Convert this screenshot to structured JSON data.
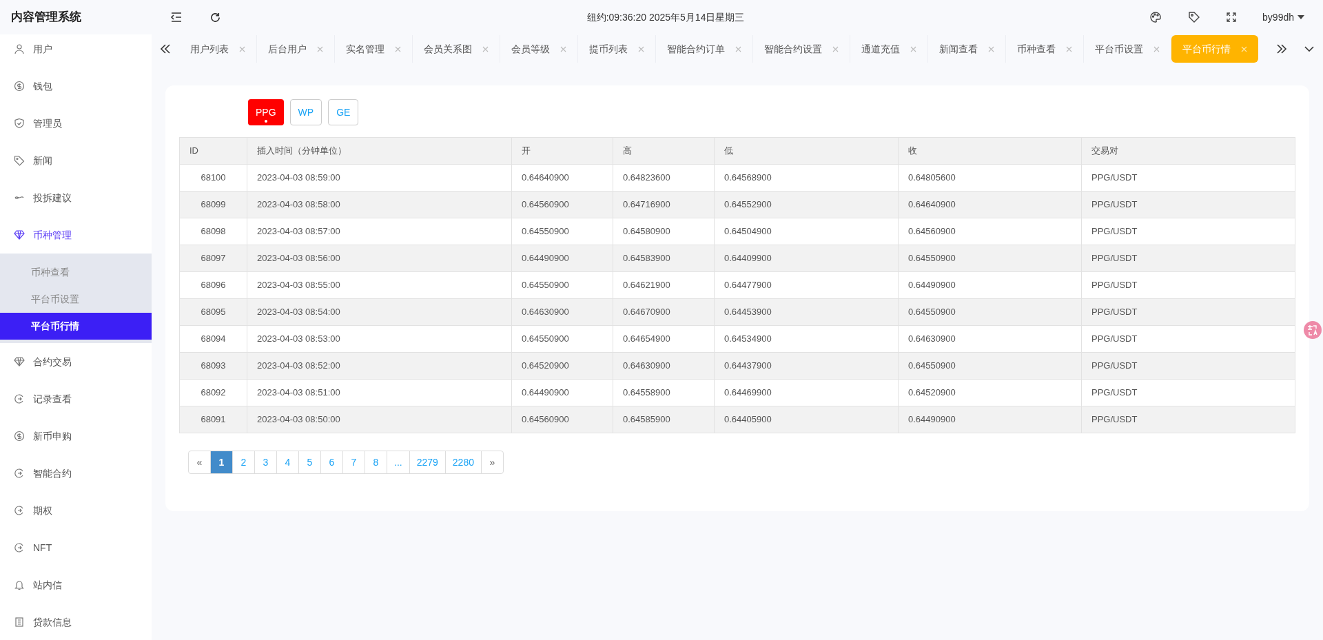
{
  "app_title": "内容管理系统",
  "header": {
    "clock": "纽约:09:36:20 2025年5月14日星期三",
    "user": "by99dh"
  },
  "sidebar": {
    "items": [
      {
        "label": "用户",
        "selected": false,
        "expanded": false
      },
      {
        "label": "钱包",
        "selected": false,
        "expanded": false
      },
      {
        "label": "管理员",
        "selected": false,
        "expanded": false
      },
      {
        "label": "新闻",
        "selected": false,
        "expanded": false
      },
      {
        "label": "投拆建议",
        "selected": false,
        "expanded": false
      },
      {
        "label": "币种管理",
        "selected": false,
        "expanded": true,
        "children": [
          {
            "label": "币种查看",
            "selected": false
          },
          {
            "label": "平台币设置",
            "selected": false
          },
          {
            "label": "平台币行情",
            "selected": true
          }
        ]
      },
      {
        "label": "合约交易",
        "selected": false,
        "expanded": false
      },
      {
        "label": "记录查看",
        "selected": false,
        "expanded": false
      },
      {
        "label": "新币申购",
        "selected": false,
        "expanded": false
      },
      {
        "label": "智能合约",
        "selected": false,
        "expanded": false
      },
      {
        "label": "期权",
        "selected": false,
        "expanded": false
      },
      {
        "label": "NFT",
        "selected": false,
        "expanded": false
      },
      {
        "label": "站内信",
        "selected": false,
        "expanded": false
      },
      {
        "label": "贷款信息",
        "selected": false,
        "expanded": false
      }
    ]
  },
  "tabs": [
    {
      "label": "用户列表",
      "selected": false
    },
    {
      "label": "后台用户",
      "selected": false
    },
    {
      "label": "实名管理",
      "selected": false
    },
    {
      "label": "会员关系图",
      "selected": false
    },
    {
      "label": "会员等级",
      "selected": false
    },
    {
      "label": "提币列表",
      "selected": false
    },
    {
      "label": "智能合约订单",
      "selected": false
    },
    {
      "label": "智能合约设置",
      "selected": false
    },
    {
      "label": "通道充值",
      "selected": false
    },
    {
      "label": "新闻查看",
      "selected": false
    },
    {
      "label": "币种查看",
      "selected": false
    },
    {
      "label": "平台币设置",
      "selected": false
    },
    {
      "label": "平台币行情",
      "selected": true
    }
  ],
  "coin_buttons": [
    {
      "label": "PPG",
      "selected": true
    },
    {
      "label": "WP",
      "selected": false
    },
    {
      "label": "GE",
      "selected": false
    }
  ],
  "table": {
    "columns": [
      "ID",
      "插入时间（分钟单位）",
      "开",
      "高",
      "低",
      "收",
      "交易对"
    ],
    "rows": [
      [
        "68100",
        "2023-04-03 08:59:00",
        "0.64640900",
        "0.64823600",
        "0.64568900",
        "0.64805600",
        "PPG/USDT"
      ],
      [
        "68099",
        "2023-04-03 08:58:00",
        "0.64560900",
        "0.64716900",
        "0.64552900",
        "0.64640900",
        "PPG/USDT"
      ],
      [
        "68098",
        "2023-04-03 08:57:00",
        "0.64550900",
        "0.64580900",
        "0.64504900",
        "0.64560900",
        "PPG/USDT"
      ],
      [
        "68097",
        "2023-04-03 08:56:00",
        "0.64490900",
        "0.64583900",
        "0.64409900",
        "0.64550900",
        "PPG/USDT"
      ],
      [
        "68096",
        "2023-04-03 08:55:00",
        "0.64550900",
        "0.64621900",
        "0.64477900",
        "0.64490900",
        "PPG/USDT"
      ],
      [
        "68095",
        "2023-04-03 08:54:00",
        "0.64630900",
        "0.64670900",
        "0.64453900",
        "0.64550900",
        "PPG/USDT"
      ],
      [
        "68094",
        "2023-04-03 08:53:00",
        "0.64550900",
        "0.64654900",
        "0.64534900",
        "0.64630900",
        "PPG/USDT"
      ],
      [
        "68093",
        "2023-04-03 08:52:00",
        "0.64520900",
        "0.64630900",
        "0.64437900",
        "0.64550900",
        "PPG/USDT"
      ],
      [
        "68092",
        "2023-04-03 08:51:00",
        "0.64490900",
        "0.64558900",
        "0.64469900",
        "0.64520900",
        "PPG/USDT"
      ],
      [
        "68091",
        "2023-04-03 08:50:00",
        "0.64560900",
        "0.64585900",
        "0.64405900",
        "0.64490900",
        "PPG/USDT"
      ]
    ]
  },
  "pagination": [
    {
      "label": "«",
      "selected": false
    },
    {
      "label": "1",
      "selected": true
    },
    {
      "label": "2",
      "selected": false
    },
    {
      "label": "3",
      "selected": false
    },
    {
      "label": "4",
      "selected": false
    },
    {
      "label": "5",
      "selected": false
    },
    {
      "label": "6",
      "selected": false
    },
    {
      "label": "7",
      "selected": false
    },
    {
      "label": "8",
      "selected": false
    },
    {
      "label": "...",
      "selected": false
    },
    {
      "label": "2279",
      "selected": false
    },
    {
      "label": "2280",
      "selected": false
    },
    {
      "label": "»",
      "selected": false
    }
  ]
}
